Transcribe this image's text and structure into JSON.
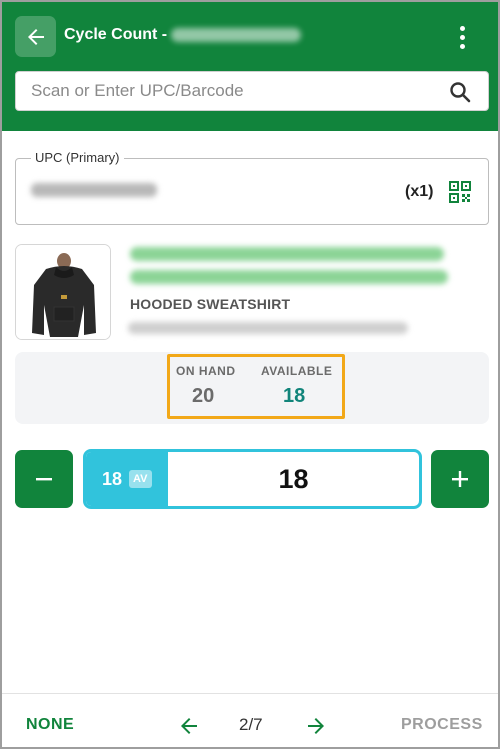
{
  "header": {
    "title": "Cycle Count -",
    "search_placeholder": "Scan or Enter UPC/Barcode"
  },
  "upc": {
    "label": "UPC (Primary)",
    "multiplier": "(x1)"
  },
  "product": {
    "subtitle": "HOODED SWEATSHIRT"
  },
  "stock": {
    "on_hand_label": "ON HAND",
    "on_hand_value": "20",
    "available_label": "AVAILABLE",
    "available_value": "18"
  },
  "quantity": {
    "chip_value": "18",
    "chip_badge": "AV",
    "value": "18"
  },
  "footer": {
    "none_label": "NONE",
    "page_indicator": "2/7",
    "process_label": "PROCESS"
  },
  "colors": {
    "brand_green": "#11843c",
    "accent_cyan": "#31c3dc",
    "highlight_orange": "#f2a818",
    "available_teal": "#11847a"
  },
  "icons": [
    "back-arrow-icon",
    "more-vert-icon",
    "search-icon",
    "qr-code-icon",
    "minus-icon",
    "plus-icon",
    "arrow-left-icon",
    "arrow-right-icon"
  ]
}
